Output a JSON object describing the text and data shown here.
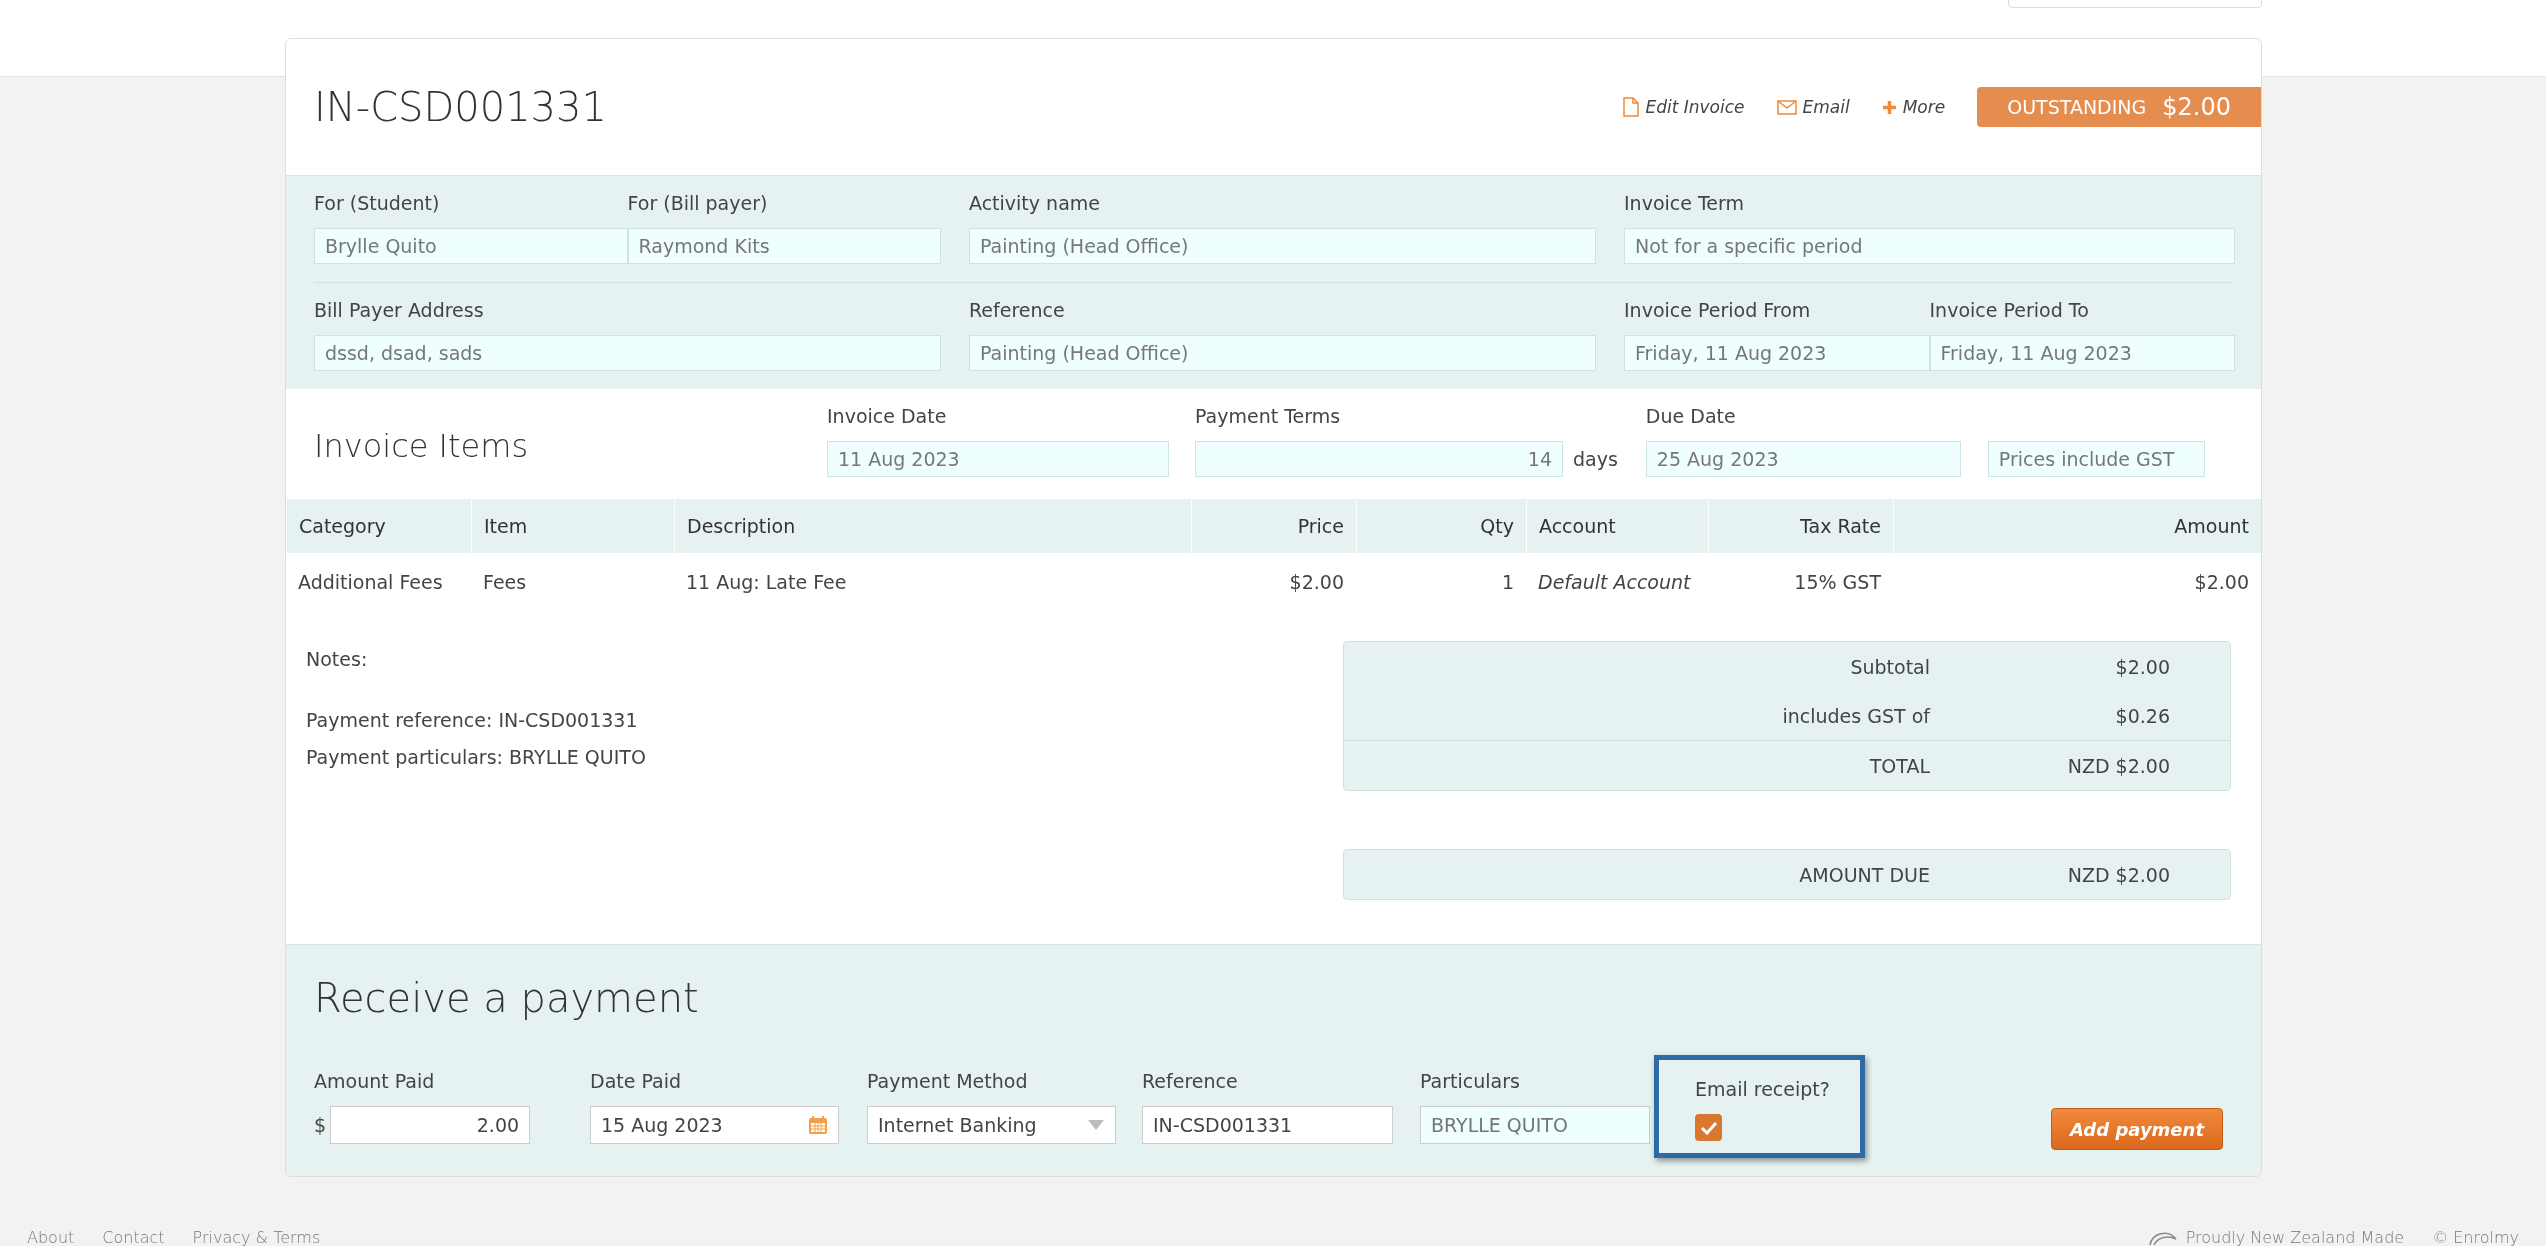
{
  "header": {
    "title": "IN-CSD001331",
    "actions": [
      {
        "kind": "file",
        "label": "Edit Invoice"
      },
      {
        "kind": "mail",
        "label": "Email"
      },
      {
        "kind": "plus",
        "label": "More"
      }
    ],
    "status": {
      "label": "OUTSTANDING",
      "amount": "$2.00"
    }
  },
  "details": [
    [
      {
        "fields": [
          {
            "label": "For (Student)",
            "value": "Brylle Quito"
          },
          {
            "label": "For (Bill payer)",
            "value": "Raymond Kits"
          }
        ]
      },
      {
        "fields": [
          {
            "label": "Activity name",
            "value": "Painting (Head Office)"
          }
        ]
      },
      {
        "fields": [
          {
            "label": "Invoice Term",
            "value": "Not for a specific period"
          }
        ]
      }
    ],
    [
      {
        "fields": [
          {
            "label": "Bill Payer Address",
            "value": "dssd, dsad, sads"
          }
        ]
      },
      {
        "fields": [
          {
            "label": "Reference",
            "value": "Painting (Head Office)"
          }
        ]
      },
      {
        "fields": [
          {
            "label": "Invoice Period From",
            "value": "Friday, 11 Aug 2023"
          },
          {
            "label": "Invoice Period To",
            "value": "Friday, 11 Aug 2023"
          }
        ]
      }
    ]
  ],
  "invoice_items": {
    "title": "Invoice Items",
    "invoice_date": {
      "label": "Invoice Date",
      "value": "11 Aug 2023"
    },
    "payment_terms": {
      "label": "Payment Terms",
      "value": "14",
      "unit": "days"
    },
    "due_date": {
      "label": "Due Date",
      "value": "25 Aug 2023"
    },
    "tax_mode": "Prices include GST"
  },
  "table": {
    "columns": [
      "Category",
      "Item",
      "Description",
      "Price",
      "Qty",
      "Account",
      "Tax Rate",
      "Amount"
    ],
    "rows": [
      [
        "Additional Fees",
        "Fees",
        "11 Aug: Late Fee",
        "$2.00",
        "1",
        "Default Account",
        "15% GST",
        "$2.00"
      ]
    ]
  },
  "notes": {
    "title": "Notes:",
    "lines": [
      "Payment reference: IN-CSD001331",
      "Payment particulars: BRYLLE QUITO"
    ]
  },
  "totals": [
    {
      "label": "Subtotal",
      "value": "$2.00"
    },
    {
      "label": "includes GST of",
      "value": "$0.26"
    },
    {
      "label": "TOTAL",
      "value": "NZD $2.00"
    }
  ],
  "amount_due": {
    "label": "AMOUNT DUE",
    "value": "NZD $2.00"
  },
  "payment": {
    "title": "Receive a payment",
    "amount": {
      "label": "Amount Paid",
      "currency": "$",
      "value": "2.00"
    },
    "date": {
      "label": "Date Paid",
      "value": "15 Aug 2023"
    },
    "method": {
      "label": "Payment Method",
      "value": "Internet Banking"
    },
    "reference": {
      "label": "Reference",
      "value": "IN-CSD001331"
    },
    "particulars": {
      "label": "Particulars",
      "placeholder": "BRYLLE QUITO"
    },
    "email_receipt": {
      "label": "Email receipt?",
      "checked": true
    },
    "button": "Add payment"
  },
  "footer": {
    "links": [
      "About",
      "Contact",
      "Privacy & Terms"
    ],
    "made": "Proudly New Zealand Made",
    "copyright": "© Enrolmy"
  }
}
